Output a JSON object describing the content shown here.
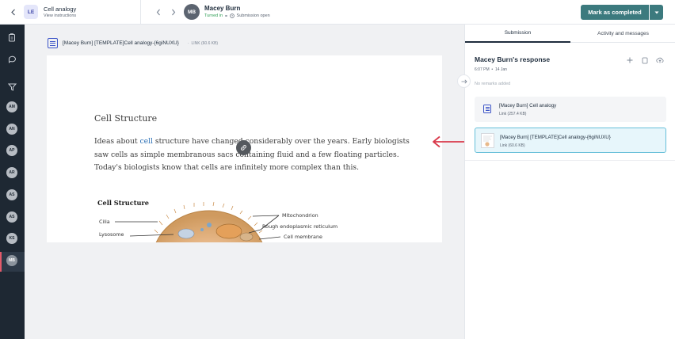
{
  "header": {
    "assignment_badge": "LE",
    "assignment_title": "Cell analogy",
    "assignment_subtitle": "View instructions",
    "student_initials": "MB",
    "student_name": "Macey Burn",
    "status_turned_in": "Turned in",
    "status_submission": "Submission open",
    "mark_completed_label": "Mark as completed"
  },
  "sidebar": {
    "students": [
      "AM",
      "AN",
      "AP",
      "AR",
      "AS",
      "AS",
      "KS",
      "MB"
    ],
    "active_student": "MB"
  },
  "viewer": {
    "file_title": "[Macey Burn] [TEMPLATE]Cell analogy-{6giNUXU}",
    "file_meta": "LINK (60.6 KB)",
    "doc_heading": "Cell Structure",
    "doc_para_pre": "Ideas about ",
    "doc_para_cell": "cell",
    "doc_para_post": " structure have changed considerably over the years. Early biologists saw cells as simple membranous sacs containing fluid and a few floating particles. Today's biologists know that cells are infinitely more complex than this.",
    "diagram_title": "Cell Structure",
    "labels": {
      "cilia": "Cilia",
      "lysosome": "Lysosome",
      "mitochondrion": "Mitochondrion",
      "rough_er": "Rough endoplasmic reticulum",
      "cell_membrane": "Cell membrane"
    }
  },
  "panel": {
    "tab_submission": "Submission",
    "tab_activity": "Activity and messages",
    "response_title": "Macey Burn's response",
    "response_time": "6:07 PM",
    "response_date": "14 Jan",
    "remarks": "No remarks added",
    "attachments": [
      {
        "name": "[Macey Burn] Cell analogy",
        "size": "Link (257.4 KB)"
      },
      {
        "name": "[Macey Burn] [TEMPLATE]Cell analogy-{6giNUXU}",
        "size": "Link (60.6 KB)"
      }
    ]
  },
  "colors": {
    "accent": "#3c7a7e",
    "sidebar_bg": "#1e2833",
    "arrow": "#d9384a",
    "selected_attachment_border": "#66bfd9"
  }
}
